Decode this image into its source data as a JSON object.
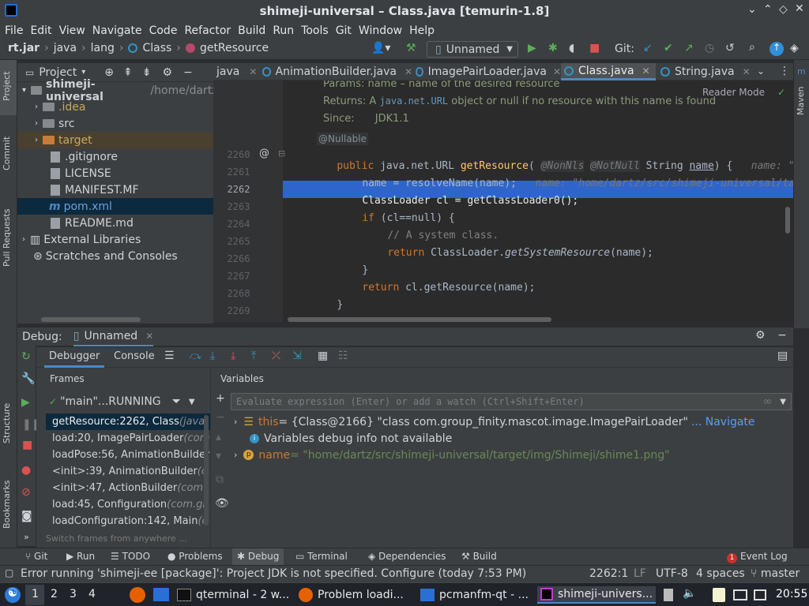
{
  "titlebar": {
    "title": "shimeji-universal – Class.java [temurin-1.8]"
  },
  "menu": [
    "File",
    "Edit",
    "View",
    "Navigate",
    "Code",
    "Refactor",
    "Build",
    "Run",
    "Tools",
    "Git",
    "Window",
    "Help"
  ],
  "breadcrumbs": [
    "rt.jar",
    "java",
    "lang",
    "Class",
    "getResource"
  ],
  "toolbar": {
    "run_config": "Unnamed",
    "git_label": "Git:"
  },
  "project": {
    "header": "Project",
    "root": "shimeji-universal",
    "root_path": "/home/dartz",
    "items": [
      ".idea",
      "src",
      "target",
      ".gitignore",
      "LICENSE",
      "MANIFEST.MF",
      "pom.xml",
      "README.md",
      "External Libraries",
      "Scratches and Consoles"
    ]
  },
  "editor_tabs": [
    "java",
    "AnimationBuilder.java",
    "ImagePairLoader.java",
    "Class.java",
    "String.java"
  ],
  "editor": {
    "reader_mode": "Reader Mode",
    "doc_params": "Params: name – name of the desired resource",
    "doc_returns_a": "Returns: A ",
    "doc_returns_code": "java.net.URL",
    "doc_returns_b": " object or null if no resource with this name is found",
    "doc_since_label": "Since:",
    "doc_since_value": "JDK1.1",
    "annotation": "@Nullable",
    "lines": [
      "2260",
      "2261",
      "2262",
      "2263",
      "2264",
      "2265",
      "2266",
      "2267",
      "2268",
      "2269"
    ],
    "code": {
      "l2260_kw": "public",
      "l2260_a": " java.net.URL ",
      "l2260_fn": "getResource",
      "l2260_b": "( ",
      "l2260_ann1": "@NonNls",
      "l2260_ann2": "@NotNull",
      "l2260_c": " String ",
      "l2260_param": "name",
      "l2260_d": ") {",
      "l2260_hint": "name: \"hom",
      "l2261": "name = resolveName(name);",
      "l2261_hint": "name: \"home/dartz/src/shimeji-universal/targe",
      "l2262": "ClassLoader cl = getClassLoader0();",
      "l2263_kw": "if",
      "l2263": " (cl==null) {",
      "l2264": "// A system class.",
      "l2265_kw": "return",
      "l2265_a": " ClassLoader.",
      "l2265_fn": "getSystemResource",
      "l2265_b": "(name);",
      "l2266": "}",
      "l2267_kw": "return",
      "l2267": " cl.getResource(name);",
      "l2268": "}"
    }
  },
  "debug": {
    "label": "Debug:",
    "config": "Unnamed",
    "tab_debugger": "Debugger",
    "tab_console": "Console",
    "frames_header": "Frames",
    "variables_header": "Variables",
    "thread": "\"main\"...RUNNING",
    "frames": [
      {
        "m": "getResource:2262, Class ",
        "c": "(java."
      },
      {
        "m": "load:20, ImagePairLoader ",
        "c": "(com"
      },
      {
        "m": "loadPose:56, AnimationBuilder",
        "c": ""
      },
      {
        "m": "<init>:39, AnimationBuilder ",
        "c": "(c"
      },
      {
        "m": "<init>:47, ActionBuilder ",
        "c": "(com."
      },
      {
        "m": "load:45, Configuration ",
        "c": "(com.gr"
      },
      {
        "m": "loadConfiguration:142, Main ",
        "c": "(c"
      }
    ],
    "switch_frames": "Switch frames from anywhere ...",
    "eval_placeholder": "Evaluate expression (Enter) or add a watch (Ctrl+Shift+Enter)",
    "var_this_name": "this",
    "var_this_value": " = {Class@2166} \"class com.group_finity.mascot.image.ImagePairLoader\"",
    "var_navigate": "... Navigate",
    "var_info": "Variables debug info not available",
    "var_name_name": "name",
    "var_name_value": " = \"home/dartz/src/shimeji-universal/target/img/Shimeji/shime1.png\""
  },
  "bottom_tabs": [
    "Git",
    "Run",
    "TODO",
    "Problems",
    "Debug",
    "Terminal",
    "Dependencies",
    "Build"
  ],
  "event_log": "Event Log",
  "event_count": "1",
  "status": {
    "message": "Error running 'shimeji-ee [package]': Project JDK is not specified. Configure (today 7:53 PM)",
    "position": "2262:1",
    "line_sep": "LF",
    "encoding": "UTF-8",
    "indent": "4 spaces",
    "branch": "master"
  },
  "left_tools": [
    "Project",
    "Commit",
    "Pull Requests",
    "Structure",
    "Bookmarks"
  ],
  "right_tools": [
    "Maven"
  ],
  "taskbar": {
    "workspaces": [
      "1",
      "2",
      "3",
      "4"
    ],
    "items": [
      "qterminal - 2 w...",
      "Problem loadi...",
      "pcmanfm-qt - ...",
      "shimeji-univers..."
    ],
    "clock": "20:55"
  }
}
